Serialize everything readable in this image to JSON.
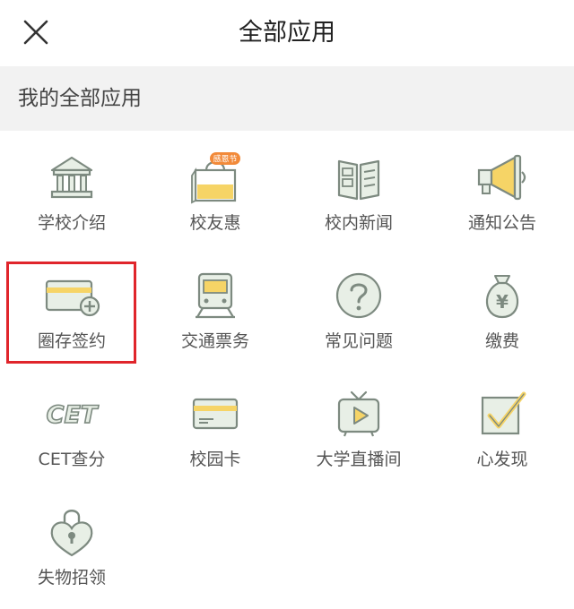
{
  "header": {
    "title": "全部应用"
  },
  "section": {
    "title": "我的全部应用"
  },
  "apps": [
    {
      "label": "学校介绍",
      "icon": "bank-icon"
    },
    {
      "label": "校友惠",
      "icon": "shopping-bag-icon",
      "badge": "感恩节"
    },
    {
      "label": "校内新闻",
      "icon": "newspaper-icon"
    },
    {
      "label": "通知公告",
      "icon": "megaphone-icon"
    },
    {
      "label": "圈存签约",
      "icon": "card-add-icon"
    },
    {
      "label": "交通票务",
      "icon": "train-icon"
    },
    {
      "label": "常见问题",
      "icon": "question-icon"
    },
    {
      "label": "缴费",
      "icon": "money-bag-icon",
      "glyph": "¥"
    },
    {
      "label": "CET查分",
      "icon": "cet-text-icon",
      "glyph": "CET"
    },
    {
      "label": "校园卡",
      "icon": "campus-card-icon"
    },
    {
      "label": "大学直播间",
      "icon": "tv-play-icon"
    },
    {
      "label": "心发现",
      "icon": "checkbox-check-icon"
    },
    {
      "label": "失物招领",
      "icon": "heart-lock-icon"
    }
  ],
  "colors": {
    "icon_fill": "#e8efe6",
    "icon_stroke": "#7d8a80",
    "accent_yellow": "#f6d466",
    "badge_orange": "#f28a3a",
    "highlight_red": "#e0252b"
  }
}
